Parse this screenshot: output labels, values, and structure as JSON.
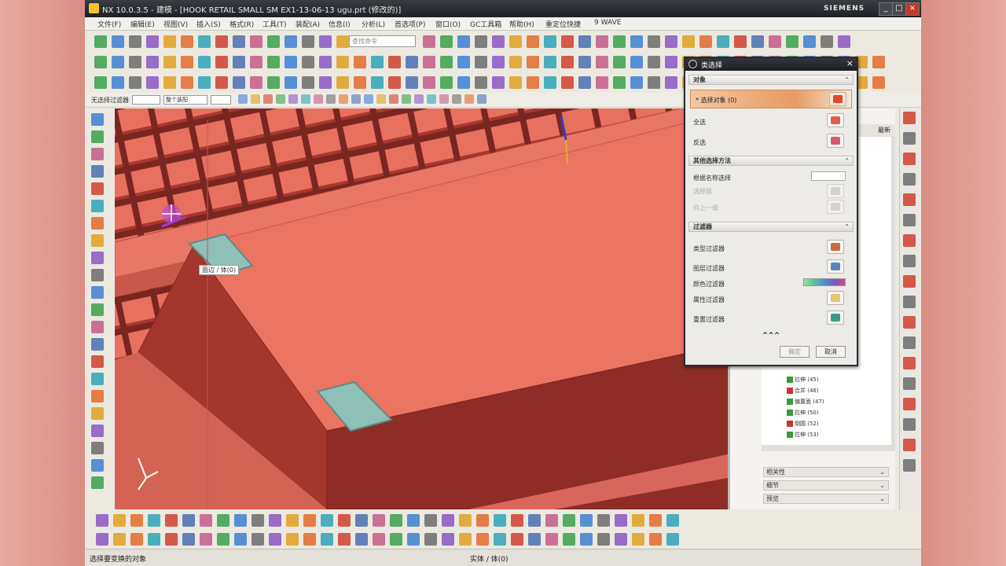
{
  "window": {
    "title": "NX 10.0.3.5 - 建模 - [HOOK RETAIL SMALL SM EX1-13-06-13 ugu.prt (修改的)]",
    "brand": "SIEMENS",
    "minimize": "_",
    "maximize": "□",
    "close": "×"
  },
  "menu": [
    "文件(F)",
    "编辑(E)",
    "视图(V)",
    "插入(S)",
    "格式(R)",
    "工具(T)",
    "装配(A)",
    "信息(I)",
    "分析(L)",
    "首选项(P)",
    "窗口(O)",
    "GC工具箱",
    "帮助(H)",
    "重定位快捷",
    "9 WAVE"
  ],
  "toolbar": {
    "search_placeholder": "查找命令"
  },
  "selection_bar": {
    "filter_label": "无选择过滤器",
    "scope_value": "整个装配",
    "type_value": "",
    "rule_value": ""
  },
  "viewport": {
    "tooltip": "面边 / 体(0)"
  },
  "dialog": {
    "title": "类选择",
    "object_section": "对象",
    "select_object": "* 选择对象 (0)",
    "select_all": "全选",
    "invert_selection": "反选",
    "other_methods_section": "其他选择方法",
    "select_by_name": "根据名称选择",
    "select_chain": "选择链",
    "up_one_level": "向上一级",
    "filter_section": "过滤器",
    "type_filter": "类型过滤器",
    "layer_filter": "图层过滤器",
    "color_filter": "颜色过滤器",
    "attribute_filter": "属性过滤器",
    "reset_filter": "重置过滤器",
    "more_toggle": "^^^",
    "ok_button": "确定",
    "cancel_button": "取消"
  },
  "navigator": {
    "column_header": "最新",
    "items": [
      "拉伸 (45)",
      "合并 (46)",
      "偏置面 (47)",
      "拉伸 (50)",
      "倒圆 (52)",
      "拉伸 (53)"
    ],
    "panels": [
      "相关性",
      "细节",
      "预览"
    ]
  },
  "status": {
    "message": "选择要变换的对象",
    "selection": "实体 / 体(0)"
  },
  "colors": {
    "model_face": "#e86e5c",
    "model_dark": "#9a2f27",
    "highlight": "#8fc0b8",
    "selected_row": "#e89a62"
  }
}
